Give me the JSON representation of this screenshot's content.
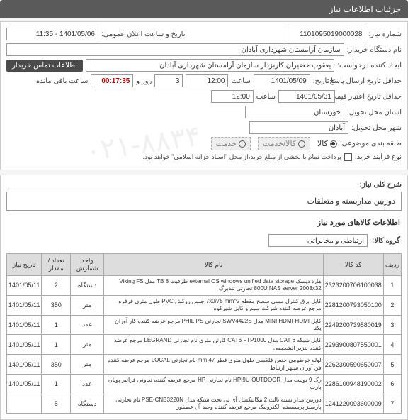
{
  "header": {
    "title": "جزئیات اطلاعات نیاز"
  },
  "form": {
    "need_no_label": "شماره نیاز:",
    "need_no": "1101095019000028",
    "announce_label": "تاریخ و ساعت اعلان عمومی:",
    "announce_value": "1401/05/06 - 11:35",
    "buyer_org_label": "نام دستگاه خریدار:",
    "buyer_org": "سازمان آرامستان شهرداری آبادان",
    "requester_label": "ایجاد کننده درخواست:",
    "requester": "یعقوب خضیران کاربزدار سازمان آرامستان شهرداری آبادان",
    "contact_btn": "اطلاعات تماس خریدار",
    "deadline_reply_label": "حداقل تاریخ ارسال پاسخ:",
    "deadline_reply_date_label": "تا تاریخ:",
    "deadline_date": "1401/05/09",
    "time_label": "ساعت",
    "deadline_time": "12:00",
    "days_label": "روز و",
    "days_value": "3",
    "remain_label": "ساعت باقی مانده",
    "remain_time": "00:17:35",
    "validity_label": "حداقل تاریخ اعتبار قیمت تا تاریخ:",
    "validity_date": "1401/05/31",
    "validity_time": "12:00",
    "province_label": "استان محل تحویل:",
    "province": "خوزستان",
    "city_label": "شهر محل تحویل:",
    "city": "آبادان",
    "category_label": "طبقه بندی موضوعی:",
    "cat_opt1": "کالا",
    "cat_opt2": "کالا/خدمت",
    "cat_opt3": "خدمت",
    "process_label": "نوع فرآیند خرید:",
    "process_note": "پرداخت تمام یا بخشی از مبلغ خرید،از محل \"اسناد خزانه اسلامی\" خواهد بود.",
    "desc_label": "شرح کلی نیاز:",
    "desc_value": "دوربین مداربسته و متعلقات",
    "items_header": "اطلاعات کالاهای مورد نیاز",
    "group_label": "گروه کالا:",
    "group_value": "ارتباطی و مخابراتی"
  },
  "table": {
    "headers": {
      "row": "ردیف",
      "code": "کد کالا",
      "name": "نام کالا",
      "unit": "واحد شمارش",
      "qty": "تعداد / مقدار",
      "date": "تاریخ نیاز"
    },
    "rows": [
      {
        "n": "1",
        "code": "2323200706100038",
        "name": "هارد دیسک external OS windows unified data storage ظرفیت TB 8 مدل Viking FS 800U NAS server 2003x32 تجارتی تندبرگ",
        "unit": "دستگاه",
        "qty": "2",
        "date": "1401/05/11"
      },
      {
        "n": "2",
        "code": "2281200793050100",
        "name": "کابل برق کنترل مسی سطح مقطع 7x0/75 mm^2 جنس روکش PVC طول متری فرفره مرجع عرضه کننده شرکت سیم و کابل شیرکوه",
        "unit": "متر",
        "qty": "350",
        "date": "1401/05/11"
      },
      {
        "n": "3",
        "code": "2249200739580019",
        "name": "کابل MINI HDMI-HDMI مدل SWV4422S تجارتی PHILIPS مرجع عرضه کننده کار آوران یکتا",
        "unit": "عدد",
        "qty": "1",
        "date": "1401/05/11"
      },
      {
        "n": "4",
        "code": "2293900807550001",
        "name": "کابل شبکه CAT 6 مدل CAT6 FTP1000 کارتن متری نام تجارتی LEGRAND مرجع عرضه کننده بنزیر الشحصی",
        "unit": "متر",
        "qty": "1",
        "date": "1401/05/11"
      },
      {
        "n": "5",
        "code": "2262300590650007",
        "name": "لوله خرطومی جنس فلکسی طول متری قطر mm 47 نام تجارتی LOCAL مرجع عرضه کننده فن آوران سپهر ارتباط",
        "unit": "متر",
        "qty": "350",
        "date": "1401/05/11"
      },
      {
        "n": "6",
        "code": "2286100948190002",
        "name": "رک 9 یونیت مدل HPI9U-OUTDOOR نام تجارتی HP مرجع عرضه کننده تعاونی فراتیر پویان پارت",
        "unit": "عدد",
        "qty": "1",
        "date": "1401/05/11"
      },
      {
        "n": "7",
        "code": "1241220093600009",
        "name": "دوربین مدار بسته بالت 2 مگاپیکسل آی پی تحت شبکه مدل PSE-CNB3220N نام تجارتی پارسیز پرسیستم الکترونیک مرجع عرضه کننده وحید آل عصفور",
        "unit": "دستگاه",
        "qty": "5",
        "date": ""
      }
    ]
  },
  "watermark": "۰۲۱-۸۸۳۴"
}
